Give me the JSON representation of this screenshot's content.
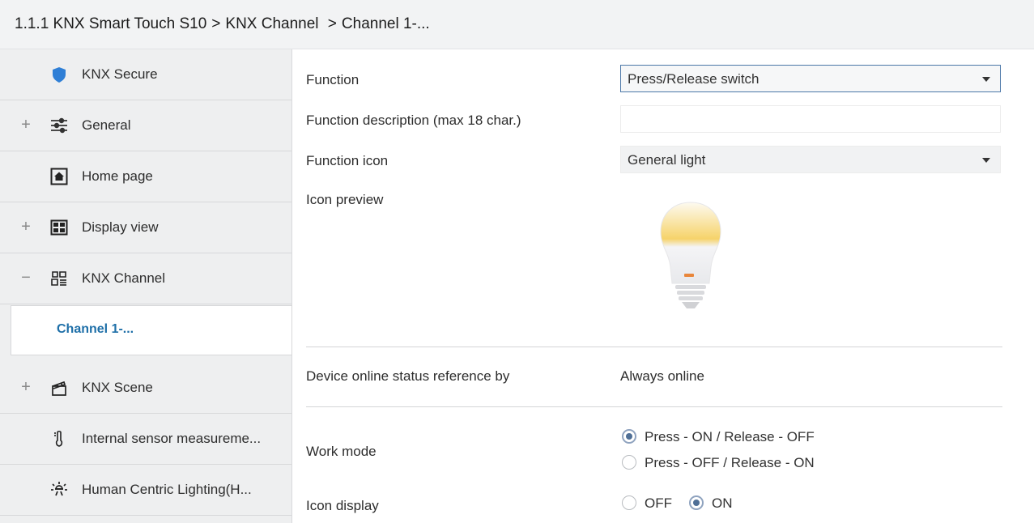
{
  "breadcrumb": {
    "device": "1.1.1 KNX Smart Touch S10",
    "sep1": ">",
    "channel_group": "KNX Channel",
    "sep2": ">",
    "channel": "Channel 1-..."
  },
  "sidebar": {
    "items": [
      {
        "label": "KNX Secure",
        "toggle": "",
        "icon": "shield-icon"
      },
      {
        "label": "General",
        "toggle": "+",
        "icon": "sliders-icon"
      },
      {
        "label": "Home page",
        "toggle": "",
        "icon": "home-icon"
      },
      {
        "label": "Display view",
        "toggle": "+",
        "icon": "grid-view-icon"
      },
      {
        "label": "KNX Channel",
        "toggle": "−",
        "icon": "channel-icon"
      },
      {
        "label": "Channel 1-...",
        "toggle": "",
        "icon": ""
      },
      {
        "label": "KNX Scene",
        "toggle": "+",
        "icon": "clapperboard-icon"
      },
      {
        "label": "Internal sensor measureme...",
        "toggle": "",
        "icon": "thermometer-icon"
      },
      {
        "label": "Human Centric Lighting(H...",
        "toggle": "",
        "icon": "sun-icon"
      }
    ]
  },
  "form": {
    "function_label": "Function",
    "function_value": "Press/Release switch",
    "description_label": "Function description (max 18 char.)",
    "description_value": "",
    "icon_label": "Function icon",
    "icon_value": "General light",
    "preview_label": "Icon preview",
    "online_label": "Device online status reference by",
    "online_value": "Always online",
    "work_mode_label": "Work mode",
    "work_mode_options": [
      "Press - ON / Release - OFF",
      "Press - OFF / Release - ON"
    ],
    "work_mode_selected": "Press - ON / Release - OFF",
    "icon_display_label": "Icon display",
    "icon_display_options": [
      "OFF",
      "ON"
    ],
    "icon_display_selected": "ON"
  },
  "colors": {
    "accent": "#1e6fa8",
    "shield": "#2f7fd6",
    "bulb_glow": "#f6d36a"
  }
}
